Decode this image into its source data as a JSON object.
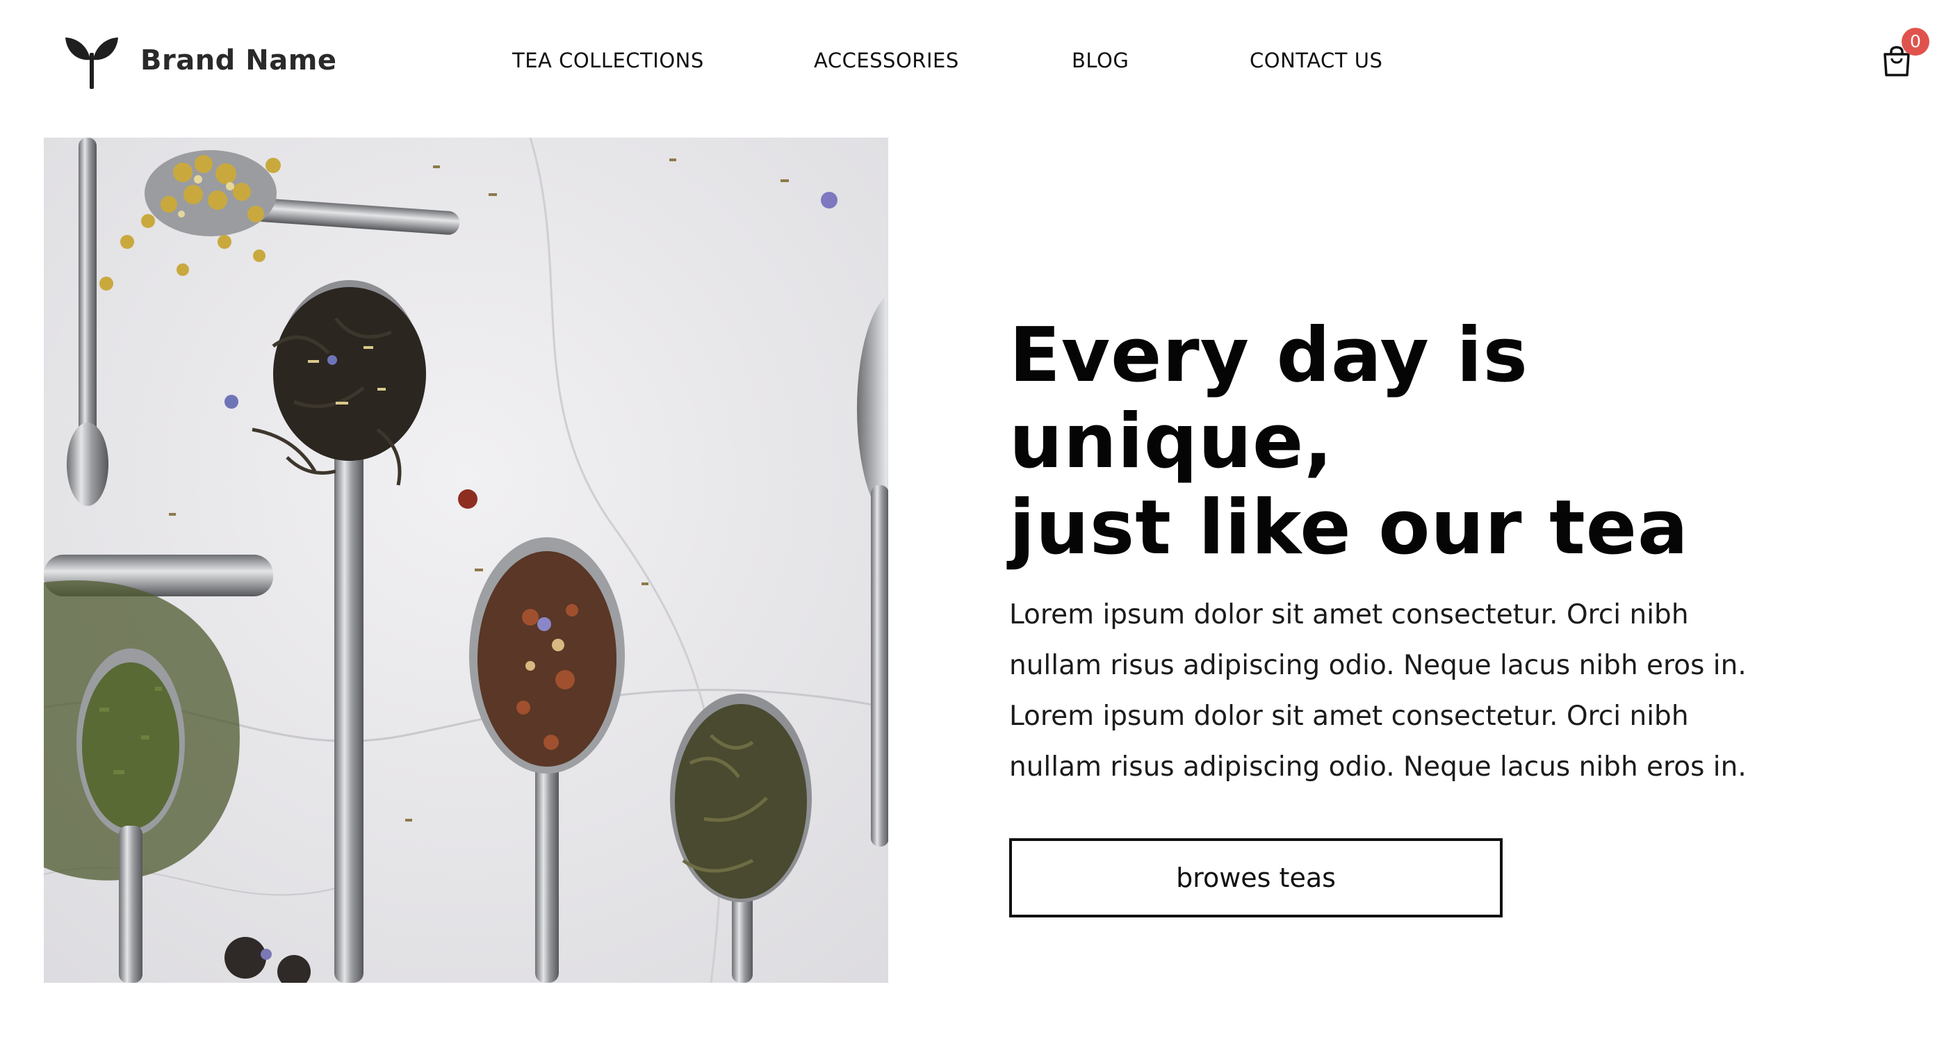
{
  "header": {
    "brand_name": "Brand Name",
    "logo_icon": "sprout-leaf-icon",
    "nav": [
      {
        "label": "TEA COLLECTIONS"
      },
      {
        "label": "ACCESSORIES"
      },
      {
        "label": "BLOG"
      },
      {
        "label": "CONTACT US"
      }
    ],
    "cart": {
      "icon": "shopping-bag-icon",
      "count": "0",
      "badge_color": "#e0534d"
    }
  },
  "hero": {
    "image_icon": "tea-spoons-photo",
    "headline_line1": "Every day is unique,",
    "headline_line2": "just like our tea",
    "body_lines": [
      "Lorem ipsum dolor sit amet consectetur. Orci nibh",
      "nullam risus adipiscing odio. Neque lacus nibh eros in.",
      "Lorem ipsum dolor sit amet consectetur. Orci nibh",
      "nullam risus adipiscing odio. Neque lacus nibh eros in."
    ],
    "cta_label": "browes teas"
  }
}
